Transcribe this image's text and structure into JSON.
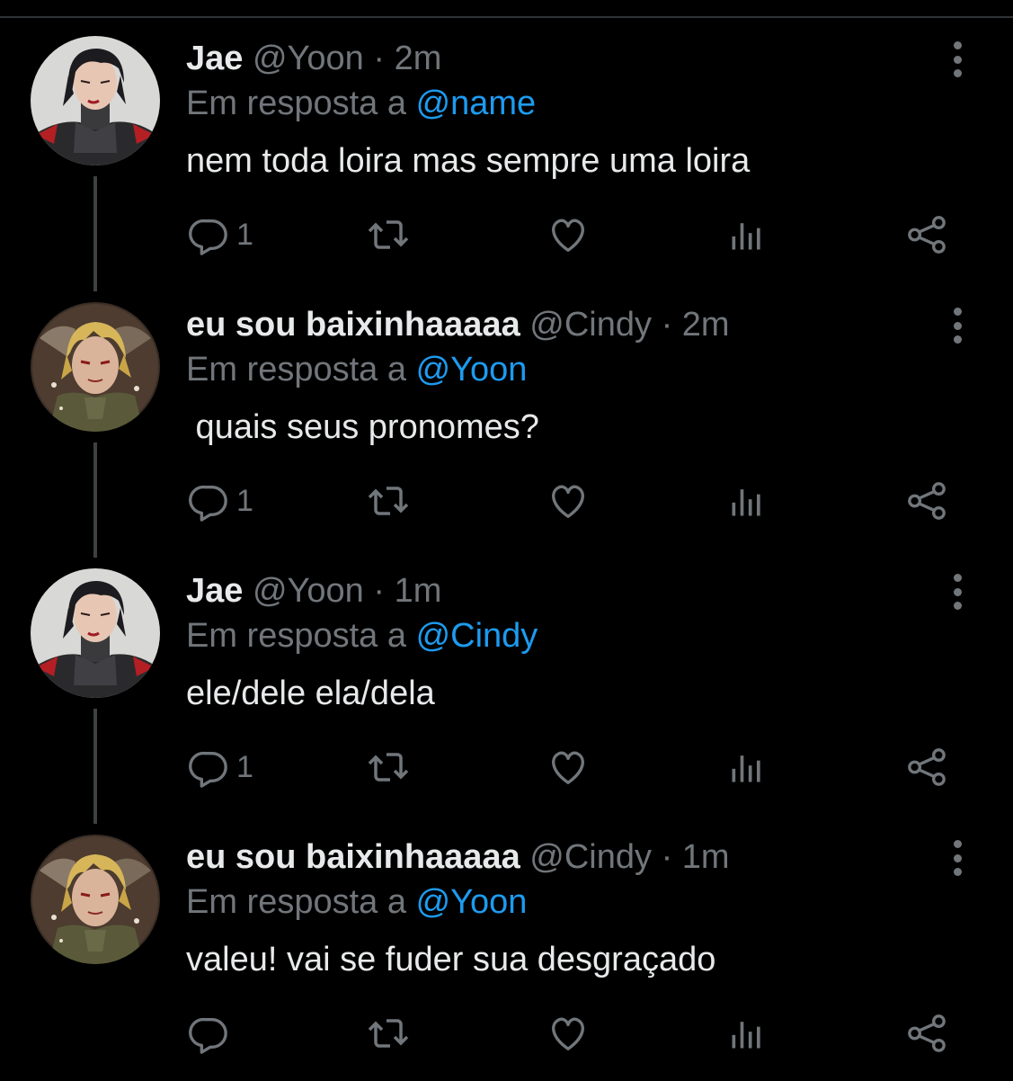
{
  "reply_prefix": "Em resposta a",
  "colors": {
    "background": "#000000",
    "text": "#e7e9ea",
    "muted": "#71767b",
    "link": "#1d9bf0"
  },
  "tweets": [
    {
      "name": "Jae",
      "handle": "@Yoon",
      "dot": "·",
      "time": "2m",
      "mention": "@name",
      "text": "nem toda loira mas sempre uma loira",
      "reply_count": "1",
      "avatar": "dark-haired-character-avatar"
    },
    {
      "name": "eu sou baixinhaaaaa",
      "handle": "@Cindy",
      "dot": "·",
      "time": "2m",
      "mention": "@Yoon",
      "text": " quais seus pronomes?",
      "reply_count": "1",
      "avatar": "blonde-character-avatar"
    },
    {
      "name": "Jae",
      "handle": "@Yoon",
      "dot": "·",
      "time": "1m",
      "mention": "@Cindy",
      "text": "ele/dele ela/dela",
      "reply_count": "1",
      "avatar": "dark-haired-character-avatar"
    },
    {
      "name": "eu sou baixinhaaaaa",
      "handle": "@Cindy",
      "dot": "·",
      "time": "1m",
      "mention": "@Yoon",
      "text": "valeu! vai se fuder sua desgraçado",
      "reply_count": "",
      "avatar": "blonde-character-avatar"
    }
  ]
}
